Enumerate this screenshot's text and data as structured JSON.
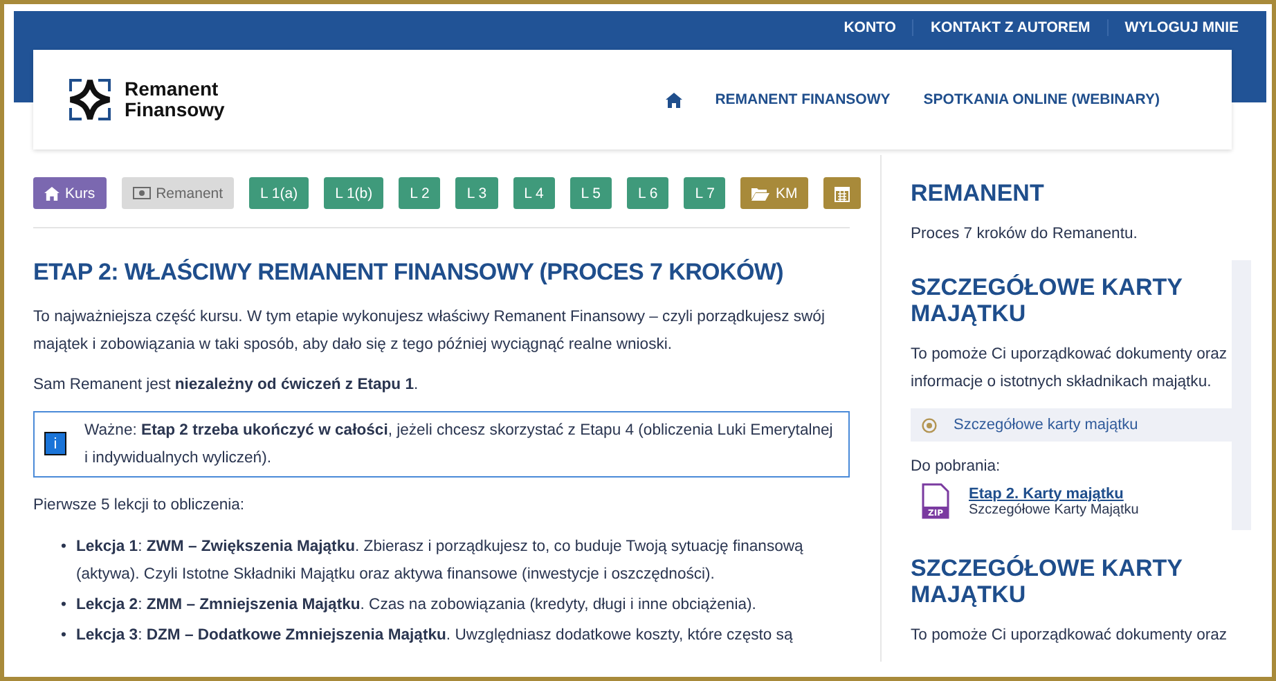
{
  "top_links": [
    "KONTO",
    "KONTAKT Z AUTOREM",
    "WYLOGUJ MNIE"
  ],
  "logo": {
    "line1": "Remanent",
    "line2": "Finansowy"
  },
  "nav": [
    {
      "kind": "home"
    },
    {
      "kind": "text",
      "label": "REMANENT FINANSOWY"
    },
    {
      "kind": "text",
      "label": "SPOTKANIA ONLINE (WEBINARY)"
    }
  ],
  "buttons": [
    {
      "kind": "home",
      "label": "Kurs",
      "disabled": false
    },
    {
      "kind": "stage",
      "label": "Remanent",
      "disabled": true
    },
    {
      "kind": "lesson",
      "label": "L 1(a)",
      "disabled": false
    },
    {
      "kind": "lesson",
      "label": "L 1(b)",
      "disabled": false
    },
    {
      "kind": "lesson",
      "label": "L 2",
      "disabled": false
    },
    {
      "kind": "lesson",
      "label": "L 3",
      "disabled": false
    },
    {
      "kind": "lesson",
      "label": "L 4",
      "disabled": false
    },
    {
      "kind": "lesson",
      "label": "L 5",
      "disabled": false
    },
    {
      "kind": "lesson",
      "label": "L 6",
      "disabled": false
    },
    {
      "kind": "lesson",
      "label": "L 7",
      "disabled": false
    },
    {
      "kind": "folder",
      "label": "KM",
      "disabled": false
    },
    {
      "kind": "calendar",
      "disabled": false
    }
  ],
  "title": "ETAP 2: WŁAŚCIWY REMANENT FINANSOWY (PROCES 7 KROKÓW)",
  "intro": [
    "To najważniejsza część kursu. W tym etapie wykonujesz właściwy Remanent Finansowy – czyli porządkujesz swój majątek i zobowiązania w taki sposób, aby dało się z tego później wyciągnąć realne wnioski.",
    "Sam Remanent jest **niezależny od ćwiczeń z Etapu 1**."
  ],
  "notice": {
    "icon": "i",
    "text": "Ważne: **Etap 2 trzeba ukończyć w całości**, jeżeli chcesz skorzystać z Etapu 4 (obliczenia Luki Emerytalnej i indywidualnych wyliczeń)."
  },
  "list_intro": "Pierwsze 5 lekcji to obliczenia:",
  "lessons": [
    {
      "bullet": "•",
      "text": "**Lekcja 1**: **ZWM – Zwiększenia Majątku**. Zbierasz i porządkujesz to, co buduje Twoją sytuację finansową (aktywa). Czyli Istotne Składniki Majątku oraz aktywa finansowe (inwestycje i oszczędności)."
    },
    {
      "bullet": "•",
      "text": "**Lekcja 2**: **ZMM – Zmniejszenia Majątku**. Czas na zobowiązania (kredyty, długi i inne obciążenia)."
    },
    {
      "bullet": "•",
      "text": "**Lekcja 3**: **DZM – Dodatkowe Zmniejszenia Majątku**. Uwzględniasz dodatkowe koszty, które często są"
    }
  ],
  "sidebar": {
    "title": "REMANENT",
    "subtitle": "Proces 7 kroków do Remanentu.",
    "panels": [
      {
        "title": "SZCZEGÓŁOWE KARTY MAJĄTKU",
        "text": "To pomoże Ci uporządkować dokumenty oraz informacje o istotnych składnikach majątku.",
        "items": [
          {
            "label": "Szczegółowe karty majątku",
            "selected": true
          }
        ],
        "downloads_label": "Do pobrania:",
        "files": [
          {
            "badge": "ZIP",
            "name": "Etap 2. Karty majątku",
            "caption": "Szczegółowe Karty Majątku"
          }
        ]
      },
      {
        "title": "SZCZEGÓŁOWE KARTY MAJĄTKU",
        "text": "To pomoże Ci uporządkować dokumenty oraz"
      }
    ]
  }
}
